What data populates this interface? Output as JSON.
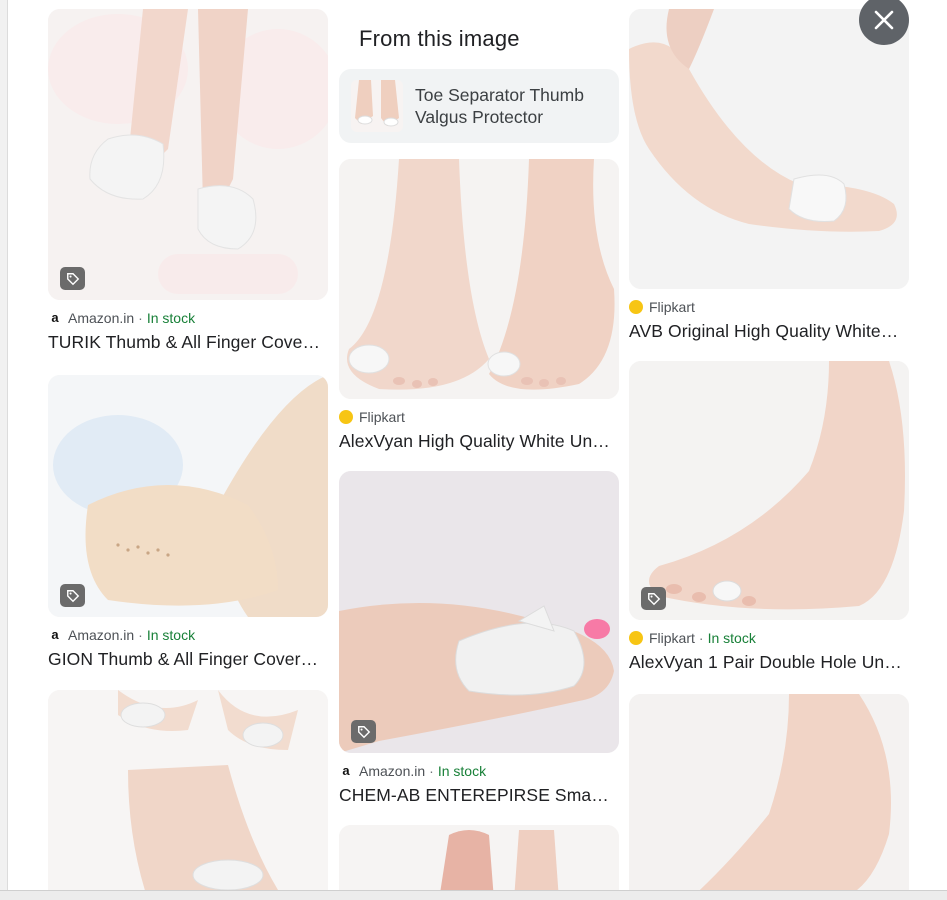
{
  "panel": {
    "heading": "From this image",
    "chip_label": "Toe Separator Thumb Valgus Protector",
    "close_icon": "close-icon"
  },
  "colors": {
    "stock_green": "#188038",
    "source_gray": "#4d5156",
    "badge_gray": "#6b6b6b",
    "close_bg": "#5f6368"
  },
  "columns": [
    [
      {
        "source": "Amazon.in",
        "source_icon": "amazon-icon",
        "separator": "·",
        "stock": "In stock",
        "title": "TURIK Thumb & All Finger Cove…",
        "has_tag": true
      },
      {
        "source": "Amazon.in",
        "source_icon": "amazon-icon",
        "separator": "·",
        "stock": "In stock",
        "title": "GION Thumb & All Finger Cover…",
        "has_tag": true
      },
      {
        "has_tag": false
      }
    ],
    [
      {
        "source": "Flipkart",
        "source_icon": "flipkart-icon",
        "title": "AlexVyan High Quality White Un…",
        "has_tag": false
      },
      {
        "source": "Amazon.in",
        "source_icon": "amazon-icon",
        "separator": "·",
        "stock": "In stock",
        "title": "CHEM-AB ENTEREPIRSE Sma…",
        "has_tag": true
      },
      {
        "has_tag": false
      }
    ],
    [
      {
        "source": "Flipkart",
        "source_icon": "flipkart-icon",
        "title": "AVB Original High Quality White…",
        "has_tag": false
      },
      {
        "source": "Flipkart",
        "source_icon": "flipkart-icon",
        "separator": "·",
        "stock": "In stock",
        "title": "AlexVyan 1 Pair Double Hole Un…",
        "has_tag": true
      },
      {
        "has_tag": false
      }
    ]
  ]
}
